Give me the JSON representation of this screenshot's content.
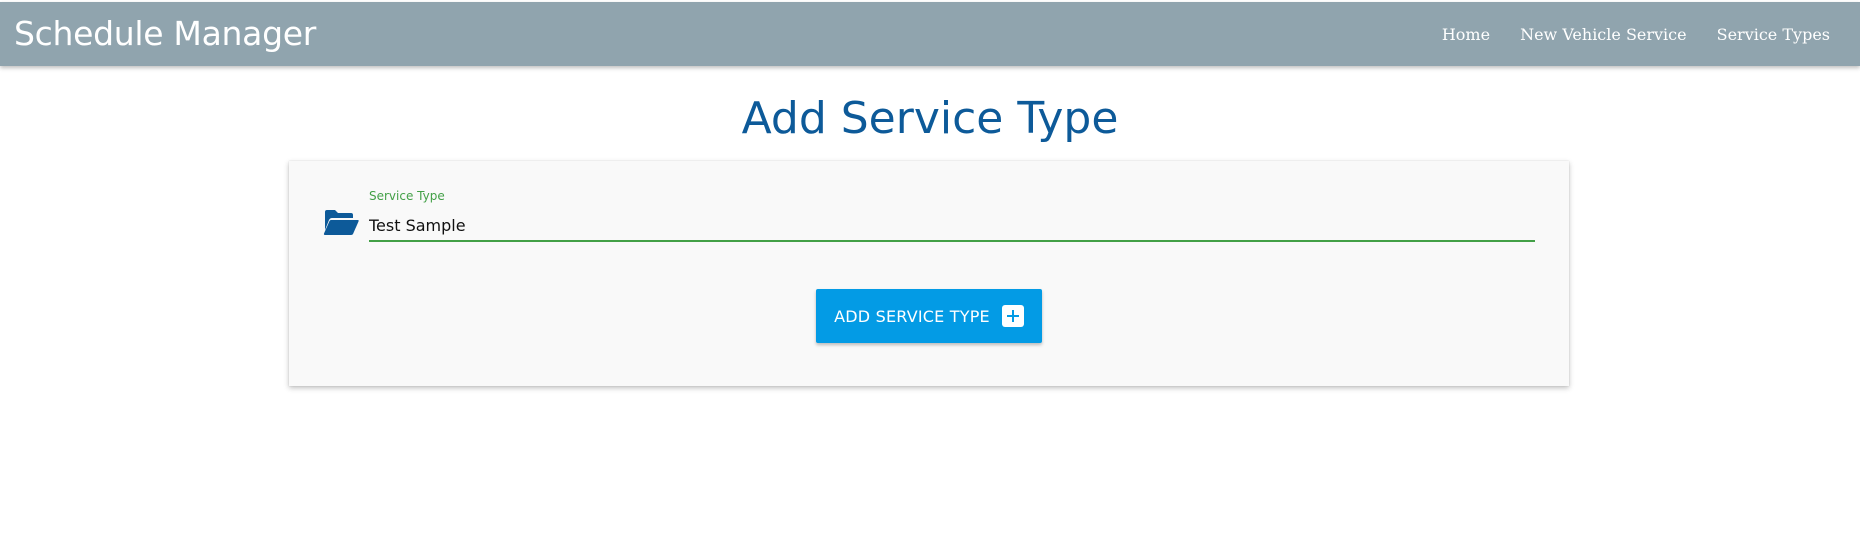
{
  "navbar": {
    "brand": "Schedule Manager",
    "links": [
      {
        "label": "Home"
      },
      {
        "label": "New Vehicle Service"
      },
      {
        "label": "Service Types"
      }
    ]
  },
  "page": {
    "title": "Add Service Type"
  },
  "form": {
    "service_type_label": "Service Type",
    "service_type_value": "Test Sample",
    "folder_icon": "folder-open-icon",
    "submit_label": "ADD SERVICE TYPE",
    "submit_icon": "plus-box-icon"
  },
  "colors": {
    "navbar_bg": "#90a4ae",
    "title": "#0d5a99",
    "accent_green": "#43a047",
    "button_bg": "#039be5",
    "folder_icon": "#0d5a99"
  }
}
